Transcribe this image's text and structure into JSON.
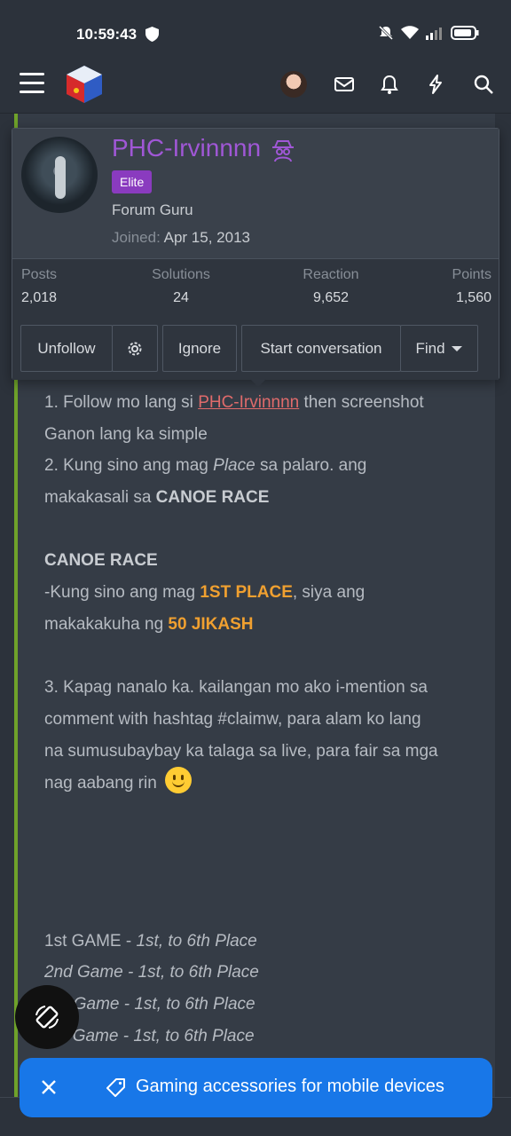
{
  "status_bar": {
    "time": "10:59:43"
  },
  "member": {
    "name": "PHC-Irvinnnn",
    "badge": "Elite",
    "title": "Forum Guru",
    "joined_label": "Joined:",
    "joined_date": "Apr 15, 2013",
    "stats": [
      {
        "label": "Posts",
        "value": "2,018"
      },
      {
        "label": "Solutions",
        "value": "24"
      },
      {
        "label": "Reaction",
        "value": "9,652"
      },
      {
        "label": "Points",
        "value": "1,560"
      }
    ],
    "buttons": {
      "unfollow": "Unfollow",
      "ignore": "Ignore",
      "start_conversation": "Start conversation",
      "find": "Find"
    }
  },
  "post": {
    "l1_pre": "1. Follow mo lang si ",
    "l1_link": "PHC-Irvinnnn",
    "l1_post": " then screenshot",
    "l2": "Ganon lang ka simple",
    "l3_pre": "2. Kung sino ang mag ",
    "l3_em": "Place",
    "l3_post": " sa palaro. ang",
    "l4_pre": "makakasali sa ",
    "l4_b": "CANOE RACE",
    "l5_b": "CANOE RACE",
    "l6_pre": "-Kung sino ang mag ",
    "l6_gold": "1ST PLACE",
    "l6_post": ", siya ang",
    "l7_pre": "makakakuha ng ",
    "l7_gold": "50 JIKASH",
    "l8": "3. Kapag nanalo ka. kailangan mo ako i-mention sa",
    "l9": "comment with hashtag #claimw, para alam ko lang",
    "l10": "na sumusubaybay ka talaga sa live, para fair sa mga",
    "l11": "nag aabang rin",
    "g1_pre": "1st GAME - ",
    "g1_em": "1st, to 6th Place",
    "g2": "2nd Game - 1st, to 6th Place",
    "g3": "3rd Game - 1st, to 6th Place",
    "g4": "4th Game - 1st, to 6th Place"
  },
  "ad": {
    "text": "Gaming accessories for mobile devices"
  },
  "colors": {
    "accent_green": "#6fa22a",
    "name_purple": "#a057d6",
    "gold": "#f0a030",
    "ad_blue": "#1877e8"
  }
}
